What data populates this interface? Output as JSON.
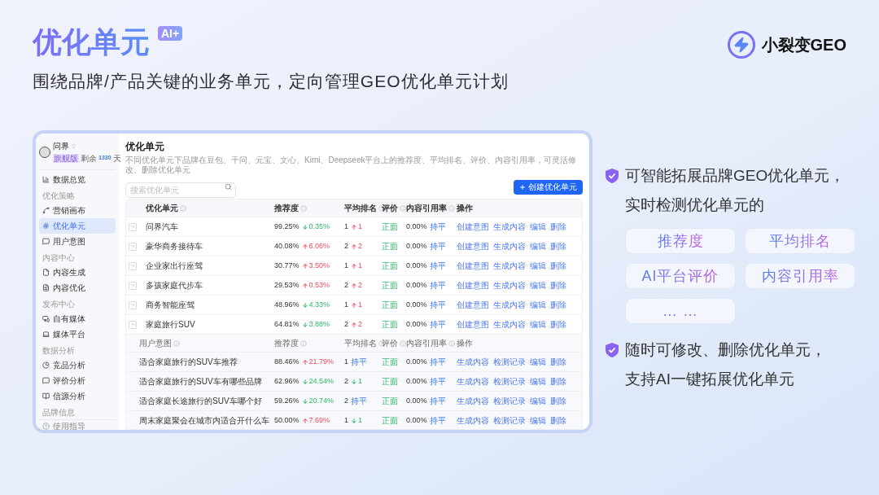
{
  "slide": {
    "title": "优化单元",
    "badge": "AI+",
    "subtitle": "围绕品牌/产品关键的业务单元，定向管理GEO优化单元计划",
    "brand": "小裂变GEO"
  },
  "app": {
    "account": {
      "name": "问界",
      "plan": "旗舰版",
      "remain": "剩余",
      "days": "1330",
      "unit": "天"
    },
    "sidebar": [
      {
        "kind": "item",
        "label": "数据总览",
        "selected": false
      },
      {
        "kind": "group",
        "label": "优化策略"
      },
      {
        "kind": "item",
        "label": "营销画布",
        "selected": false
      },
      {
        "kind": "item",
        "label": "优化单元",
        "selected": true
      },
      {
        "kind": "item",
        "label": "用户意图",
        "selected": false
      },
      {
        "kind": "group",
        "label": "内容中心"
      },
      {
        "kind": "item",
        "label": "内容生成",
        "selected": false
      },
      {
        "kind": "item",
        "label": "内容优化",
        "selected": false
      },
      {
        "kind": "group",
        "label": "发布中心"
      },
      {
        "kind": "item",
        "label": "自有媒体",
        "selected": false
      },
      {
        "kind": "item",
        "label": "媒体平台",
        "selected": false
      },
      {
        "kind": "group",
        "label": "数据分析"
      },
      {
        "kind": "item",
        "label": "竞品分析",
        "selected": false
      },
      {
        "kind": "item",
        "label": "评价分析",
        "selected": false
      },
      {
        "kind": "item",
        "label": "信源分析",
        "selected": false
      },
      {
        "kind": "group",
        "label": "品牌信息"
      }
    ],
    "footer": "使用指导",
    "page": {
      "title": "优化单元",
      "description": "不同优化单元下品牌在豆包、千问、元宝、文心、Kimi、Deepseek平台上的推荐度、平均排名、评价、内容引用率，可灵活修改、删除优化单元",
      "search_placeholder": "搜索优化单元",
      "create_button": "创建优化单元"
    },
    "table": {
      "columns": [
        "优化单元",
        "推荐度",
        "平均排名",
        "评价",
        "内容引用率",
        "操作"
      ],
      "rows": [
        {
          "name": "问界汽车",
          "expanded": false,
          "recommend": "99.25%",
          "recommend_up": false,
          "recommend_change": "0.35%",
          "rank": "1",
          "rank_up": true,
          "rank_down": false,
          "rank_change": "1",
          "rating": "正面",
          "citation": "0.00%",
          "citation_change": "持平",
          "actions": [
            "创建意图",
            "生成内容",
            "编辑",
            "删除"
          ]
        },
        {
          "name": "豪华商务接待车",
          "expanded": false,
          "recommend": "40.08%",
          "recommend_up": true,
          "recommend_change": "6.06%",
          "rank": "2",
          "rank_up": true,
          "rank_down": false,
          "rank_change": "2",
          "rating": "正面",
          "citation": "0.00%",
          "citation_change": "持平",
          "actions": [
            "创建意图",
            "生成内容",
            "编辑",
            "删除"
          ]
        },
        {
          "name": "企业家出行座驾",
          "expanded": false,
          "recommend": "30.77%",
          "recommend_up": true,
          "recommend_change": "3.50%",
          "rank": "1",
          "rank_up": true,
          "rank_down": false,
          "rank_change": "1",
          "rating": "正面",
          "citation": "0.00%",
          "citation_change": "持平",
          "actions": [
            "创建意图",
            "生成内容",
            "编辑",
            "删除"
          ]
        },
        {
          "name": "多孩家庭代步车",
          "expanded": false,
          "recommend": "29.53%",
          "recommend_up": true,
          "recommend_change": "0.53%",
          "rank": "2",
          "rank_up": true,
          "rank_down": false,
          "rank_change": "2",
          "rating": "正面",
          "citation": "0.00%",
          "citation_change": "持平",
          "actions": [
            "创建意图",
            "生成内容",
            "编辑",
            "删除"
          ]
        },
        {
          "name": "商务智能座驾",
          "expanded": false,
          "recommend": "48.96%",
          "recommend_up": false,
          "recommend_change": "4.33%",
          "rank": "1",
          "rank_up": true,
          "rank_down": false,
          "rank_change": "1",
          "rating": "正面",
          "citation": "0.00%",
          "citation_change": "持平",
          "actions": [
            "创建意图",
            "生成内容",
            "编辑",
            "删除"
          ]
        },
        {
          "name": "家庭旅行SUV",
          "expanded": true,
          "recommend": "64.81%",
          "recommend_up": false,
          "recommend_change": "3.88%",
          "rank": "2",
          "rank_up": true,
          "rank_down": false,
          "rank_change": "2",
          "rating": "正面",
          "citation": "0.00%",
          "citation_change": "持平",
          "actions": [
            "创建意图",
            "生成内容",
            "编辑",
            "删除"
          ],
          "sub_columns": [
            "用户意图",
            "推荐度",
            "平均排名",
            "评价",
            "内容引用率",
            "操作"
          ],
          "children": [
            {
              "name": "适合家庭旅行的SUV车推荐",
              "recommend": "88.46%",
              "recommend_up": true,
              "recommend_change": "21.79%",
              "rank": "1",
              "rank_up": false,
              "rank_down": false,
              "rank_change": "持平",
              "rating": "正面",
              "citation": "0.00%",
              "citation_change": "持平",
              "actions": [
                "生成内容",
                "检测记录",
                "编辑",
                "删除"
              ]
            },
            {
              "name": "适合家庭旅行的SUV车有哪些品牌",
              "recommend": "62.96%",
              "recommend_up": false,
              "recommend_change": "24.54%",
              "rank": "2",
              "rank_up": false,
              "rank_down": true,
              "rank_change": "1",
              "rating": "正面",
              "citation": "0.00%",
              "citation_change": "持平",
              "actions": [
                "生成内容",
                "检测记录",
                "编辑",
                "删除"
              ]
            },
            {
              "name": "适合家庭长途旅行的SUV车哪个好",
              "recommend": "59.26%",
              "recommend_up": false,
              "recommend_change": "20.74%",
              "rank": "2",
              "rank_up": false,
              "rank_down": false,
              "rank_change": "持平",
              "rating": "正面",
              "citation": "0.00%",
              "citation_change": "持平",
              "actions": [
                "生成内容",
                "检测记录",
                "编辑",
                "删除"
              ]
            },
            {
              "name": "周末家庭聚会在城市内适合开什么车",
              "recommend": "50.00%",
              "recommend_up": true,
              "recommend_change": "7.69%",
              "rank": "1",
              "rank_up": false,
              "rank_down": true,
              "rank_change": "1",
              "rating": "正面",
              "citation": "0.00%",
              "citation_change": "持平",
              "actions": [
                "生成内容",
                "检测记录",
                "编辑",
                "删除"
              ]
            }
          ]
        }
      ]
    }
  },
  "features": [
    {
      "lines": [
        "可智能拓展品牌GEO优化单元，",
        "实时检测优化单元的"
      ],
      "chips": [
        "推荐度",
        "平均排名",
        "AI平台评价",
        "内容引用率",
        "… …"
      ]
    },
    {
      "lines": [
        "随时可修改、删除优化单元，",
        "支持AI一键拓展优化单元"
      ]
    }
  ]
}
